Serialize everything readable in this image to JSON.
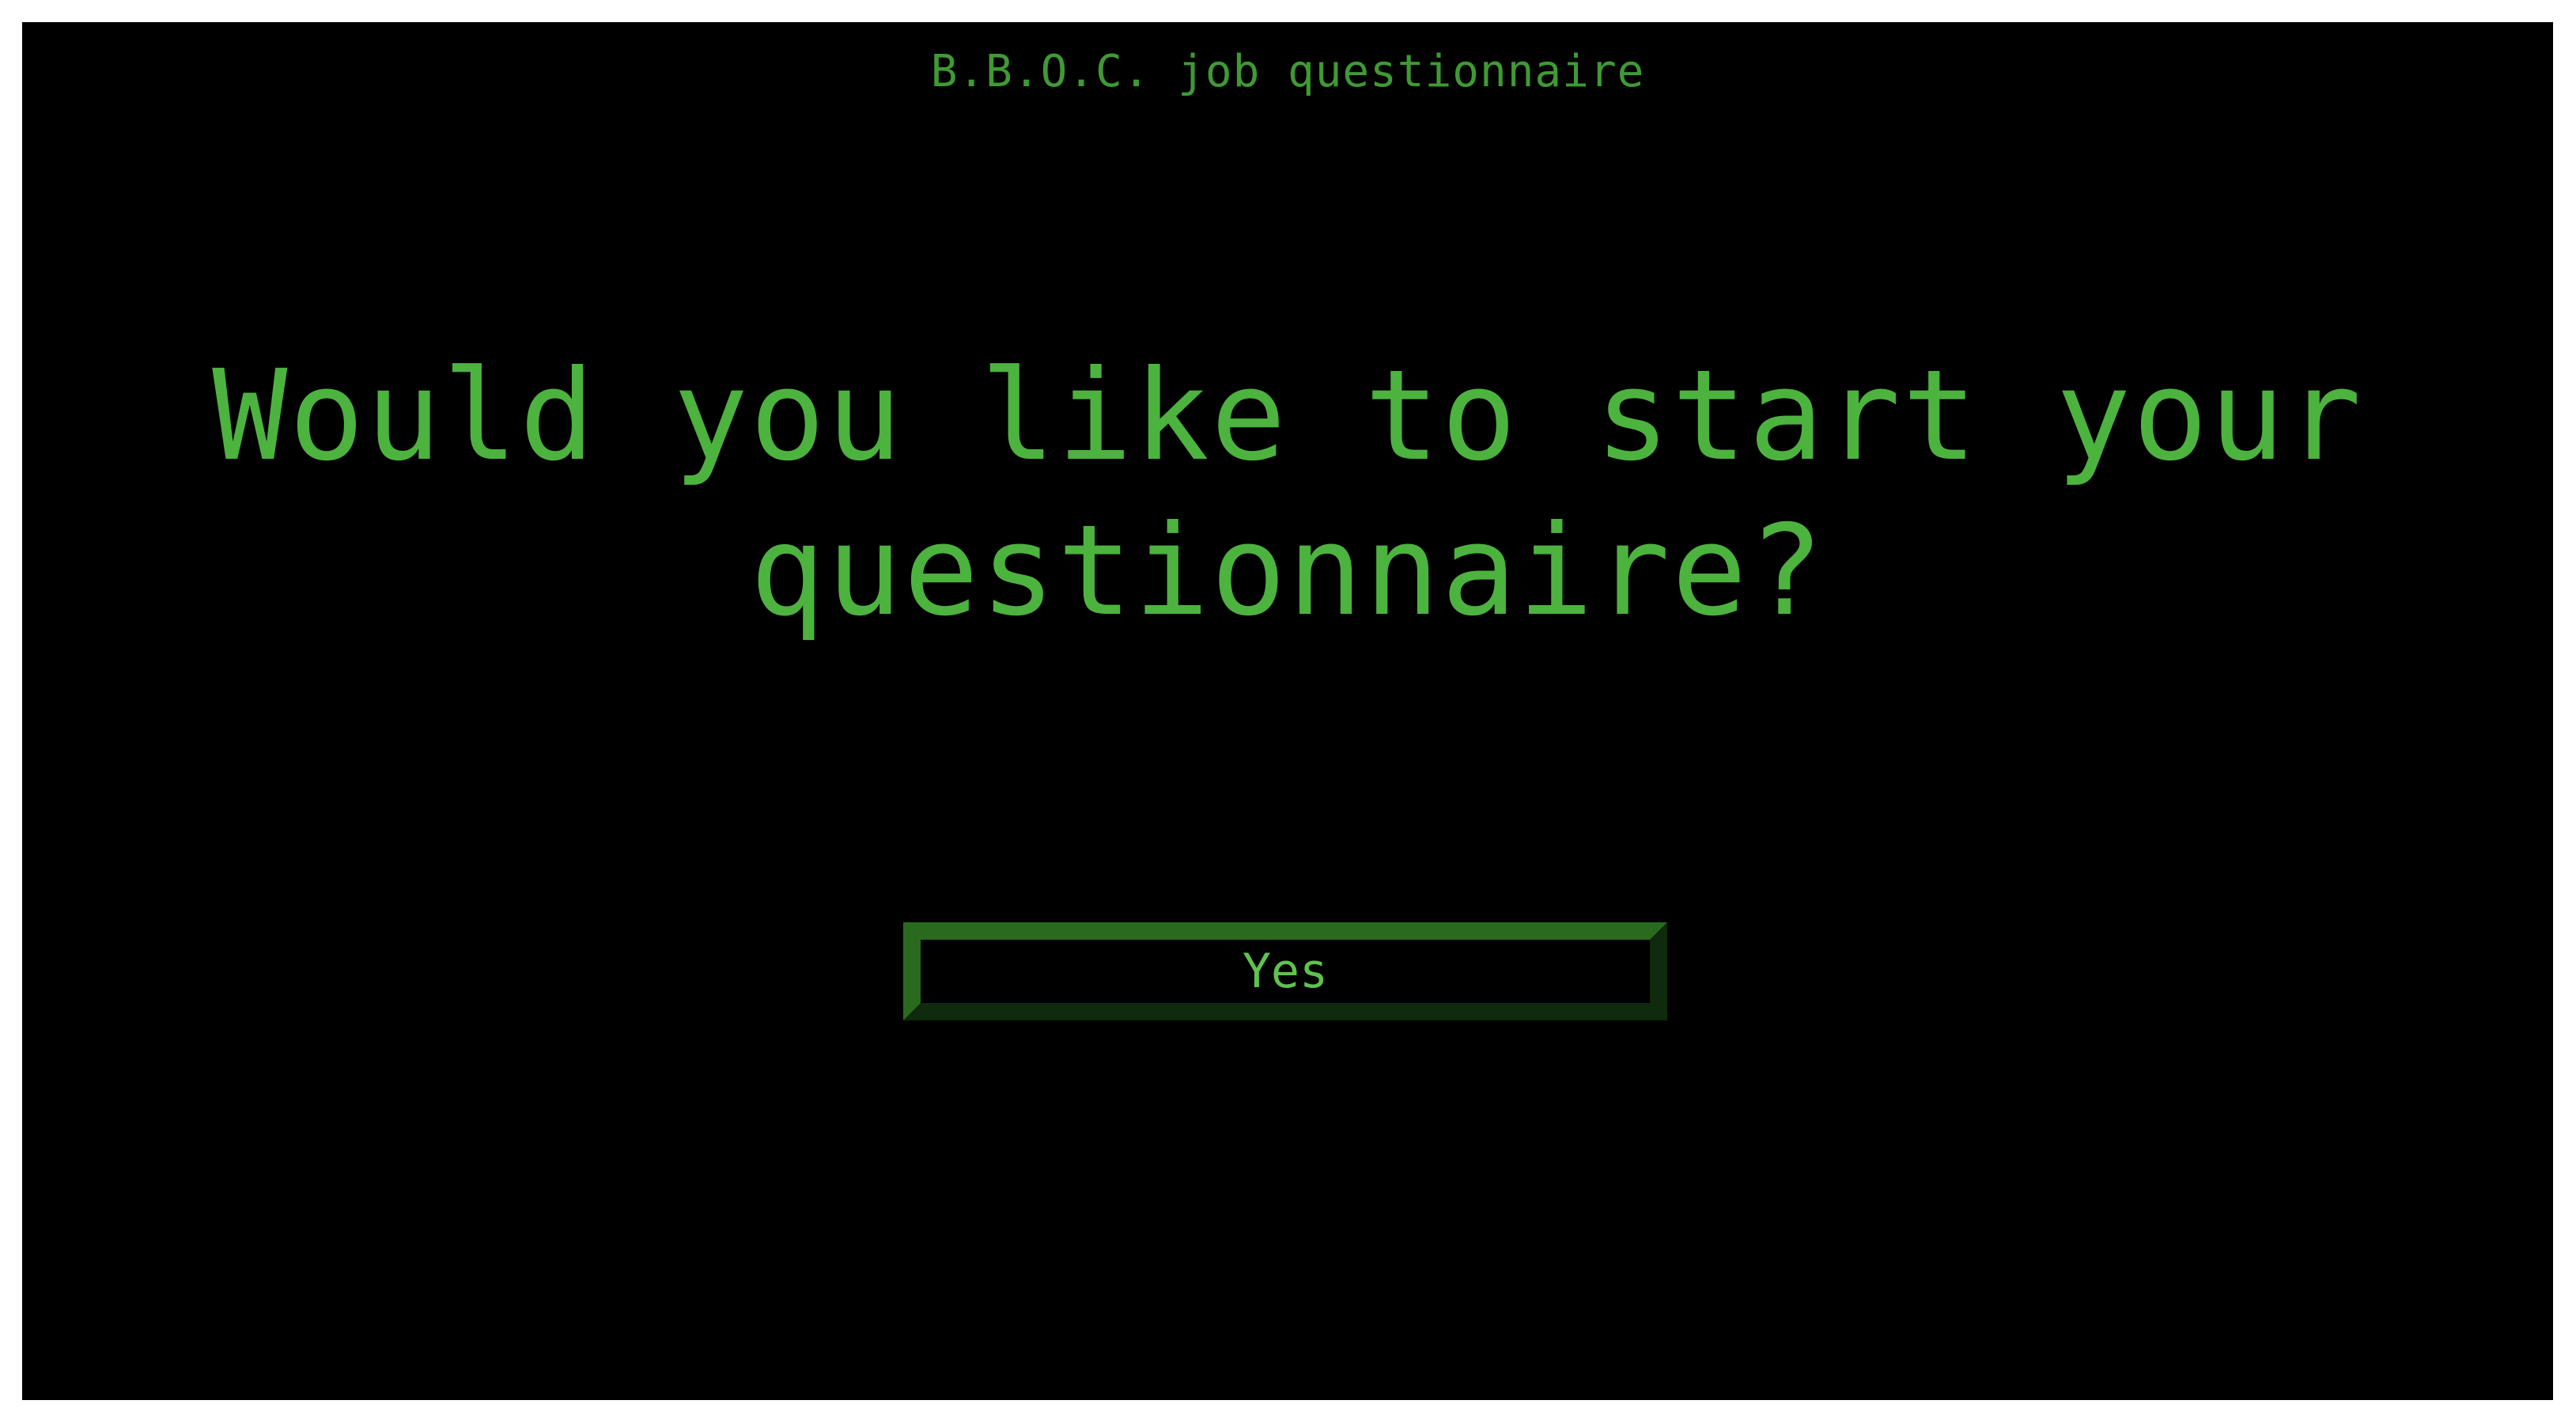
{
  "app": {
    "title": "B.B.O.C. job questionnaire"
  },
  "main": {
    "question": "Would you like to start your questionnaire?",
    "yes_label": "Yes"
  },
  "colors": {
    "background": "#000000",
    "text_green": "#4db33f",
    "button_border": "#2a6a1f",
    "button_shadow": "#0f2a0c"
  }
}
